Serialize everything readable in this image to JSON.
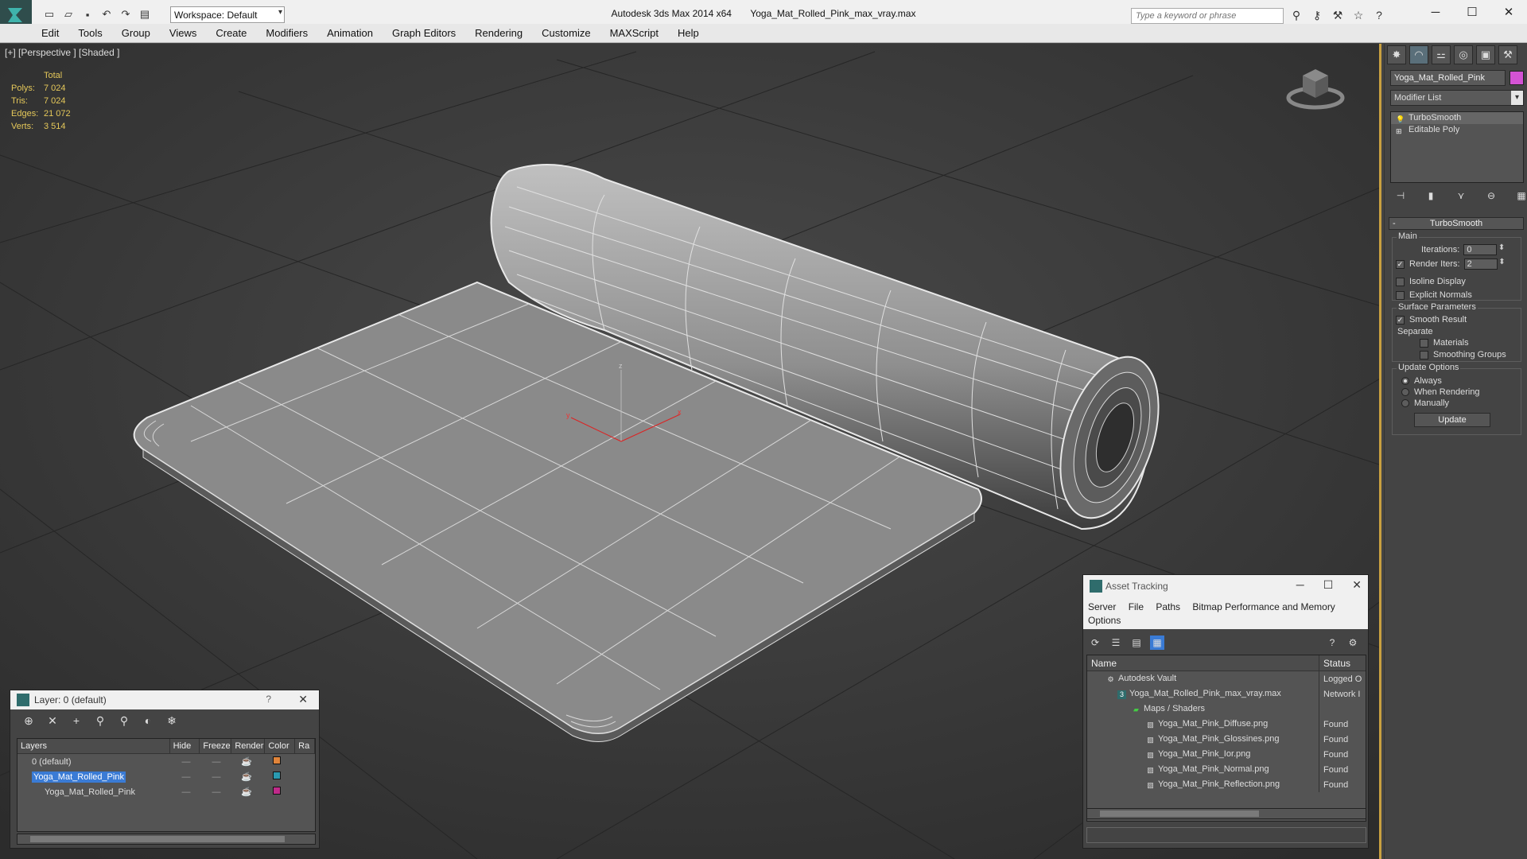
{
  "window": {
    "app_title": "Autodesk 3ds Max  2014 x64",
    "file_title": "Yoga_Mat_Rolled_Pink_max_vray.max",
    "workspace": "Workspace: Default",
    "search_placeholder": "Type a keyword or phrase"
  },
  "menu": [
    "Edit",
    "Tools",
    "Group",
    "Views",
    "Create",
    "Modifiers",
    "Animation",
    "Graph Editors",
    "Rendering",
    "Customize",
    "MAXScript",
    "Help"
  ],
  "viewport": {
    "label": "[+] [Perspective ] [Shaded ]",
    "stats": {
      "header": "Total",
      "polys_label": "Polys:",
      "polys": "7 024",
      "tris_label": "Tris:",
      "tris": "7 024",
      "edges_label": "Edges:",
      "edges": "21 072",
      "verts_label": "Verts:",
      "verts": "3 514"
    },
    "axis": {
      "x": "x",
      "y": "y",
      "z": "z"
    }
  },
  "command_panel": {
    "object_name": "Yoga_Mat_Rolled_Pink",
    "object_color": "#d453d4",
    "modifier_list": "Modifier List",
    "stack": [
      "TurboSmooth",
      "Editable Poly"
    ],
    "rollout": "TurboSmooth",
    "main_group": "Main",
    "iterations_label": "Iterations:",
    "iterations": "0",
    "render_iters_label": "Render Iters:",
    "render_iters": "2",
    "isoline": "Isoline Display",
    "explicit": "Explicit Normals",
    "surface_group": "Surface Parameters",
    "smooth_result": "Smooth Result",
    "separate": "Separate",
    "materials": "Materials",
    "smoothing_groups": "Smoothing Groups",
    "update_group": "Update Options",
    "always": "Always",
    "when_rendering": "When Rendering",
    "manually": "Manually",
    "update_btn": "Update"
  },
  "layer_dialog": {
    "title": "Layer: 0 (default)",
    "help": "?",
    "columns": [
      "Layers",
      "Hide",
      "Freeze",
      "Render",
      "Color",
      "Ra"
    ],
    "rows": [
      {
        "name": "0 (default)",
        "color": "#e0843a"
      },
      {
        "name": "Yoga_Mat_Rolled_Pink",
        "color": "#2a9ab0"
      },
      {
        "name": "Yoga_Mat_Rolled_Pink",
        "color": "#c02a8a"
      }
    ]
  },
  "asset_dialog": {
    "title": "Asset Tracking",
    "menu": [
      "Server",
      "File",
      "Paths",
      "Bitmap Performance and Memory",
      "Options"
    ],
    "col_name": "Name",
    "col_status": "Status",
    "rows": [
      {
        "name": "Autodesk Vault",
        "status": "Logged O"
      },
      {
        "name": "Yoga_Mat_Rolled_Pink_max_vray.max",
        "status": "Network I"
      },
      {
        "name": "Maps / Shaders",
        "status": ""
      },
      {
        "name": "Yoga_Mat_Pink_Diffuse.png",
        "status": "Found"
      },
      {
        "name": "Yoga_Mat_Pink_Glossines.png",
        "status": "Found"
      },
      {
        "name": "Yoga_Mat_Pink_Ior.png",
        "status": "Found"
      },
      {
        "name": "Yoga_Mat_Pink_Normal.png",
        "status": "Found"
      },
      {
        "name": "Yoga_Mat_Pink_Reflection.png",
        "status": "Found"
      }
    ]
  }
}
